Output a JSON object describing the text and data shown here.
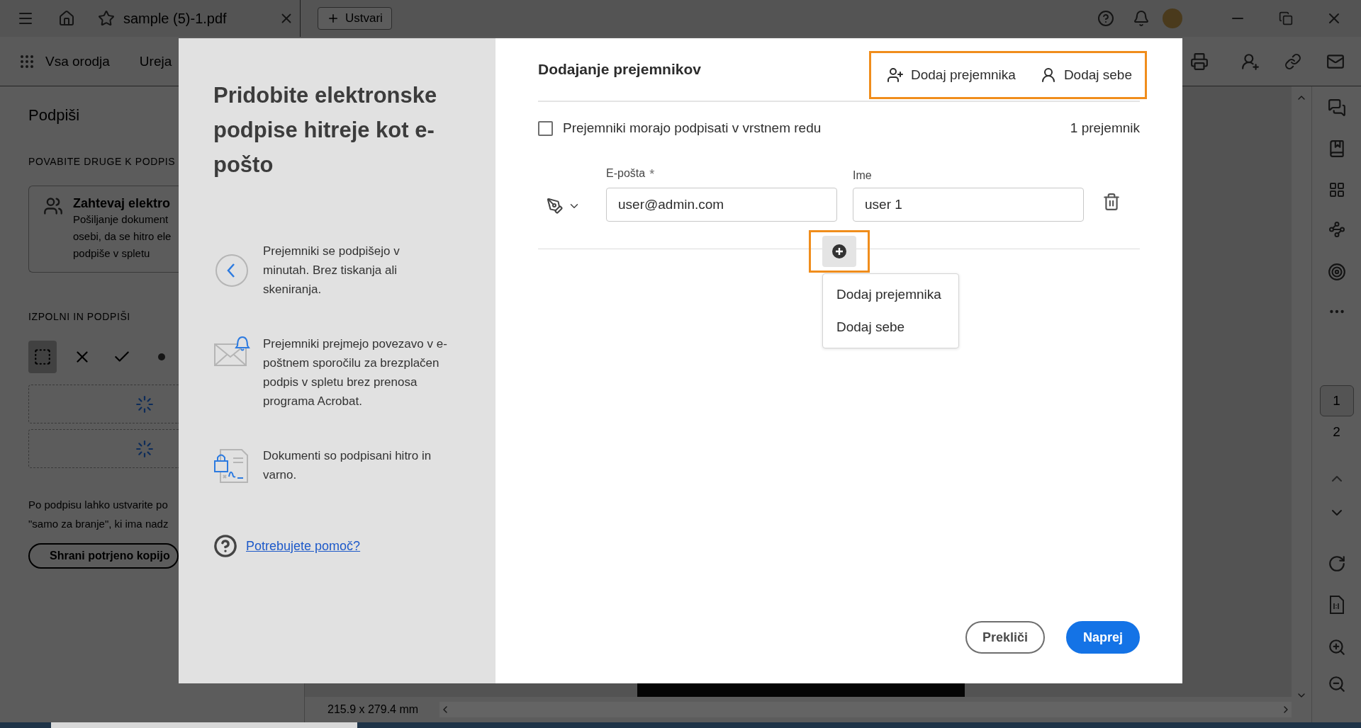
{
  "titlebar": {
    "tab": {
      "title": "sample (5)-1.pdf"
    },
    "create_button": "Ustvari"
  },
  "toolbar": {
    "all_tools": "Vsa orodja",
    "edit_partial": "Ureja"
  },
  "sign_panel": {
    "title": "Podpiši",
    "invite_heading": "POVABITE DRUGE K PODPIS",
    "request_card": {
      "title": "Zahtevaj elektro",
      "lines": [
        "Pošiljanje dokument",
        "osebi, da se hitro ele",
        "podpiše v spletu"
      ]
    },
    "fill_heading": "IZPOLNI IN PODPIŠI",
    "tools": [
      {
        "kind": "text",
        "selected": true
      },
      {
        "kind": "cross",
        "selected": false
      },
      {
        "kind": "check",
        "selected": false
      },
      {
        "kind": "dot",
        "selected": false
      }
    ],
    "note_lines": [
      "Po podpisu lahko ustvarite po",
      "\"samo za branje\", ki ima nadz"
    ],
    "save_button": "Shrani potrjeno kopijo"
  },
  "page_nav": {
    "pages": [
      {
        "label": "1",
        "selected": true
      },
      {
        "label": "2",
        "selected": false
      }
    ]
  },
  "status_bar": {
    "page_size": "215.9 x 279.4 mm"
  },
  "dialog": {
    "promo": {
      "title": "Pridobite elektronske podpise hitreje kot e-pošto",
      "features": [
        {
          "kind": "clock",
          "text": "Prejemniki se podpišejo v minutah. Brez tiskanja ali skeniranja."
        },
        {
          "kind": "mail",
          "text": "Prejemniki prejmejo povezavo v e-poštnem sporočilu za brezplačen podpis v spletu brez prenosa programa Acrobat."
        },
        {
          "kind": "secure",
          "text": "Dokumenti so podpisani hitro in varno."
        }
      ],
      "help_link": "Potrebujete pomoč?"
    },
    "title": "Dodajanje prejemnikov",
    "header_actions": [
      {
        "kind": "add-recipient",
        "label": "Dodaj prejemnika"
      },
      {
        "kind": "add-self",
        "label": "Dodaj sebe"
      }
    ],
    "order_checkbox": {
      "label": "Prejemniki morajo podpisati v vrstnem redu",
      "checked": false
    },
    "recipient_count": "1 prejemnik",
    "recipients": [
      {
        "email_label": "E-pošta",
        "required_mark": "*",
        "email": "user@admin.com",
        "name_label": "Ime",
        "name": "user 1"
      }
    ],
    "add_menu": {
      "expanded": true,
      "items": [
        "Dodaj prejemnika",
        "Dodaj sebe"
      ]
    },
    "buttons": {
      "cancel": "Prekliči",
      "next": "Naprej"
    }
  }
}
